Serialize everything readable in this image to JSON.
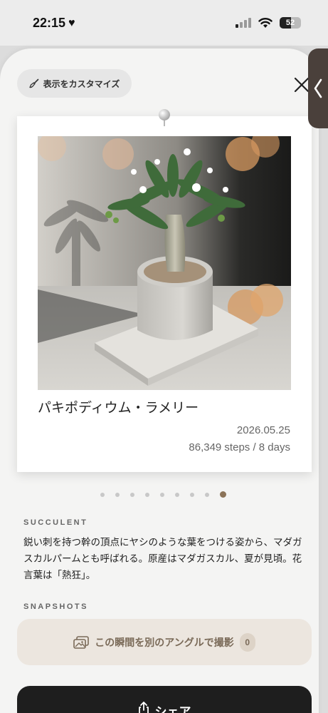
{
  "status_bar": {
    "time": "22:15",
    "battery": "52",
    "battery_level": 0.52
  },
  "toolbar": {
    "customize_label": "表示をカスタマイズ"
  },
  "card": {
    "plant_name": "パキポディウム・ラメリー",
    "date": "2026.05.25",
    "stats": "86,349 steps  /  8 days"
  },
  "pager": {
    "count": 9,
    "active_index": 8
  },
  "category": {
    "label": "SUCCULENT"
  },
  "description": {
    "text": "鋭い刺を持つ幹の頂点にヤシのような葉をつける姿から、マダガスカルパームとも呼ばれる。原産はマダガスカル、夏が見頃。花言葉は「熱狂」。"
  },
  "snapshots": {
    "label": "SNAPSHOTS",
    "button_label": "この瞬間を別のアングルで撮影",
    "count": "0"
  },
  "share": {
    "label": "シェア"
  },
  "icons": {
    "customize": "brush-icon",
    "close": "close-icon",
    "side": "chevron-left-icon",
    "snapshots": "photos-icon",
    "share": "share-icon",
    "heart": "heart-icon",
    "pin": "pin-icon"
  },
  "colors": {
    "accent": "#8b7358",
    "share_bg": "#1e1e1e",
    "snap_bg": "#ece6df"
  }
}
